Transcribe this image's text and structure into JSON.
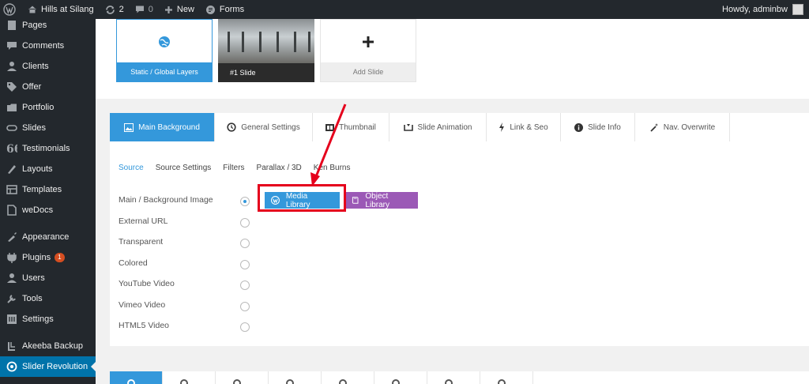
{
  "admin_bar": {
    "site_name": "Hills at Silang",
    "updates_count": "2",
    "comments_count": "0",
    "new_label": "New",
    "forms_label": "Forms",
    "howdy": "Howdy, adminbw"
  },
  "sidebar": {
    "items": [
      {
        "label": "Pages",
        "icon": "pages-icon"
      },
      {
        "label": "Comments",
        "icon": "comments-icon"
      },
      {
        "label": "Clients",
        "icon": "clients-icon"
      },
      {
        "label": "Offer",
        "icon": "offer-icon"
      },
      {
        "label": "Portfolio",
        "icon": "portfolio-icon"
      },
      {
        "label": "Slides",
        "icon": "slides-icon"
      },
      {
        "label": "Testimonials",
        "icon": "testimonials-icon"
      },
      {
        "label": "Layouts",
        "icon": "layouts-icon"
      },
      {
        "label": "Templates",
        "icon": "templates-icon"
      },
      {
        "label": "weDocs",
        "icon": "wedocs-icon"
      },
      {
        "label": "Appearance",
        "icon": "appearance-icon"
      },
      {
        "label": "Plugins",
        "icon": "plugins-icon",
        "badge": "1"
      },
      {
        "label": "Users",
        "icon": "users-icon"
      },
      {
        "label": "Tools",
        "icon": "tools-icon"
      },
      {
        "label": "Settings",
        "icon": "settings-icon"
      },
      {
        "label": "Akeeba Backup",
        "icon": "akeeba-icon"
      },
      {
        "label": "Slider Revolution",
        "icon": "slider-revolution-icon",
        "active": true
      }
    ]
  },
  "slides": {
    "static_label": "Static / Global Layers",
    "slide1_label": "#1 Slide",
    "add_label": "Add Slide"
  },
  "tabs": [
    {
      "label": "Main Background",
      "icon": "image-icon",
      "active": true
    },
    {
      "label": "General Settings",
      "icon": "history-icon"
    },
    {
      "label": "Thumbnail",
      "icon": "thumbnail-icon"
    },
    {
      "label": "Slide Animation",
      "icon": "animation-icon"
    },
    {
      "label": "Link & Seo",
      "icon": "bolt-icon"
    },
    {
      "label": "Slide Info",
      "icon": "info-icon"
    },
    {
      "label": "Nav. Overwrite",
      "icon": "wand-icon"
    }
  ],
  "subtabs": [
    "Source",
    "Source Settings",
    "Filters",
    "Parallax / 3D",
    "Ken Burns"
  ],
  "sources": [
    {
      "label": "Main / Background Image",
      "checked": true
    },
    {
      "label": "External URL"
    },
    {
      "label": "Transparent"
    },
    {
      "label": "Colored"
    },
    {
      "label": "YouTube Video"
    },
    {
      "label": "Vimeo Video"
    },
    {
      "label": "HTML5 Video"
    }
  ],
  "buttons": {
    "media_library": "Media Library",
    "object_library": "Object Library"
  },
  "colors": {
    "accent": "#3498db",
    "object_library": "#9b59b6",
    "wp_admin_dark": "#23282d",
    "wp_active_blue": "#0073aa",
    "annotation_red": "#e5001c"
  }
}
